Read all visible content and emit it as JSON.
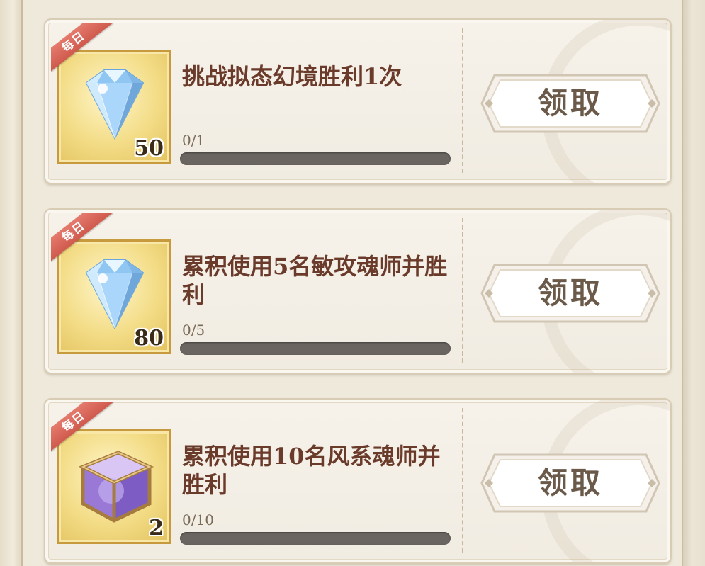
{
  "tasks": [
    {
      "badge": "每日",
      "title": "挑战拟态幻境胜利1次",
      "progress_text": "0/1",
      "progress_fraction": 0,
      "reward": {
        "icon": "diamond-icon",
        "quantity": "50"
      },
      "claim_label": "领取"
    },
    {
      "badge": "每日",
      "title": "累积使用5名敏攻魂师并胜利",
      "progress_text": "0/5",
      "progress_fraction": 0,
      "reward": {
        "icon": "diamond-icon",
        "quantity": "80"
      },
      "claim_label": "领取"
    },
    {
      "badge": "每日",
      "title": "累积使用10名风系魂师并胜利",
      "progress_text": "0/10",
      "progress_fraction": 0,
      "reward": {
        "icon": "crystal-cube-icon",
        "quantity": "2"
      },
      "claim_label": "领取"
    }
  ],
  "colors": {
    "badge": "#d9665a",
    "title": "#6a3a2a",
    "progress_track": "#6a6560",
    "reward_tile": "#f3dc86",
    "claim_text": "#6b5a4a"
  }
}
